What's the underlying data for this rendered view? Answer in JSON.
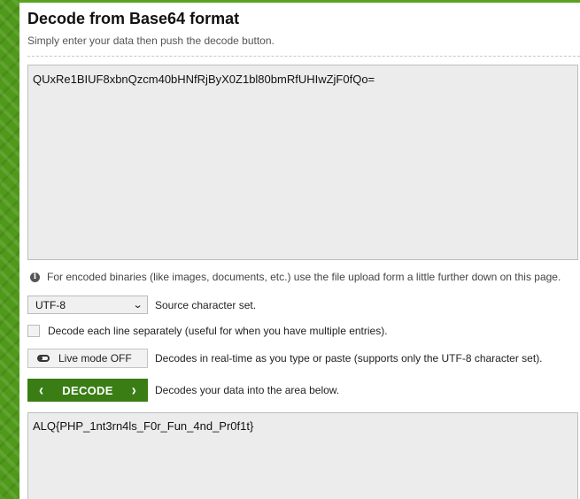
{
  "header": {
    "title": "Decode from Base64 format",
    "subtitle": "Simply enter your data then push the decode button."
  },
  "input": {
    "value": "QUxRe1BIUF8xbnQzcm40bHNfRjByX0Z1bl80bmRfUHIwZjF0fQo="
  },
  "info": {
    "icon": "info-icon",
    "text": "For encoded binaries (like images, documents, etc.) use the file upload form a little further down on this page."
  },
  "charset": {
    "selected": "UTF-8",
    "label": "Source character set."
  },
  "each_line": {
    "checked": false,
    "label": "Decode each line separately (useful for when you have multiple entries)."
  },
  "live_mode": {
    "button_label": "Live mode OFF",
    "description": "Decodes in real-time as you type or paste (supports only the UTF-8 character set)."
  },
  "decode": {
    "button_label": "DECODE",
    "description": "Decodes your data into the area below."
  },
  "output": {
    "value": "ALQ{PHP_1nt3rn4ls_F0r_Fun_4nd_Pr0f1t}"
  },
  "colors": {
    "accent_green": "#3a7d14",
    "side_strip": "#4f9a1a"
  }
}
